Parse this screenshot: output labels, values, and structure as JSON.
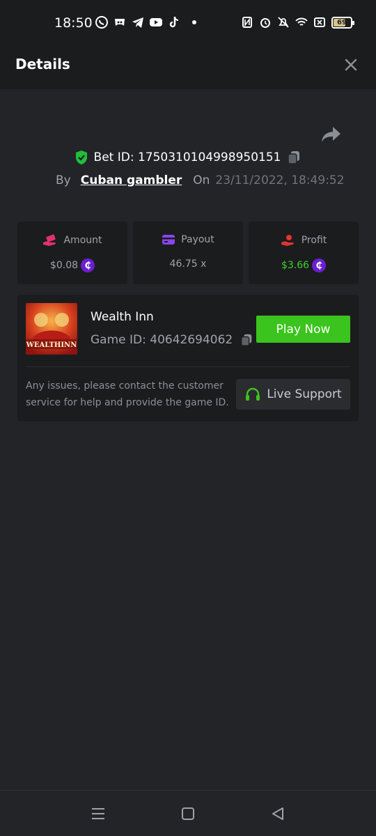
{
  "status_bar": {
    "time": "18:50",
    "battery": "69",
    "app_icons": [
      "whatsapp-icon",
      "discord-icon",
      "telegram-icon",
      "youtube-icon",
      "tiktok-icon"
    ],
    "system_icons": [
      "nfc-icon",
      "alarm-icon",
      "mute-icon",
      "wifi-icon",
      "sim-icon",
      "battery-icon"
    ]
  },
  "header": {
    "title": "Details"
  },
  "bet": {
    "id_label": "Bet ID: 1750310104998950151",
    "by_label": "By",
    "username": "Cuban gambler",
    "on_label": "On",
    "date": "23/11/2022, 18:49:52"
  },
  "stats": {
    "amount_label": "Amount",
    "amount_value": "$0.08",
    "payout_label": "Payout",
    "payout_value": "46.75 x",
    "profit_label": "Profit",
    "profit_value": "$3.66",
    "coin_glyph": "₵"
  },
  "game": {
    "name": "Wealth Inn",
    "id_label": "Game ID: 40642694062",
    "thumb_text": "WEALTHINN",
    "play_label": "Play Now",
    "issue_text": "Any issues, please contact the customer service for help and provide the game ID.",
    "support_label": "Live Support"
  },
  "colors": {
    "background": "#232427",
    "panel": "#1b1c1e",
    "accent_green": "#3bc41d",
    "profit_green": "#3fd12a",
    "coin_purple": "#6a1fd0",
    "shield_green": "#1fbf3a"
  }
}
